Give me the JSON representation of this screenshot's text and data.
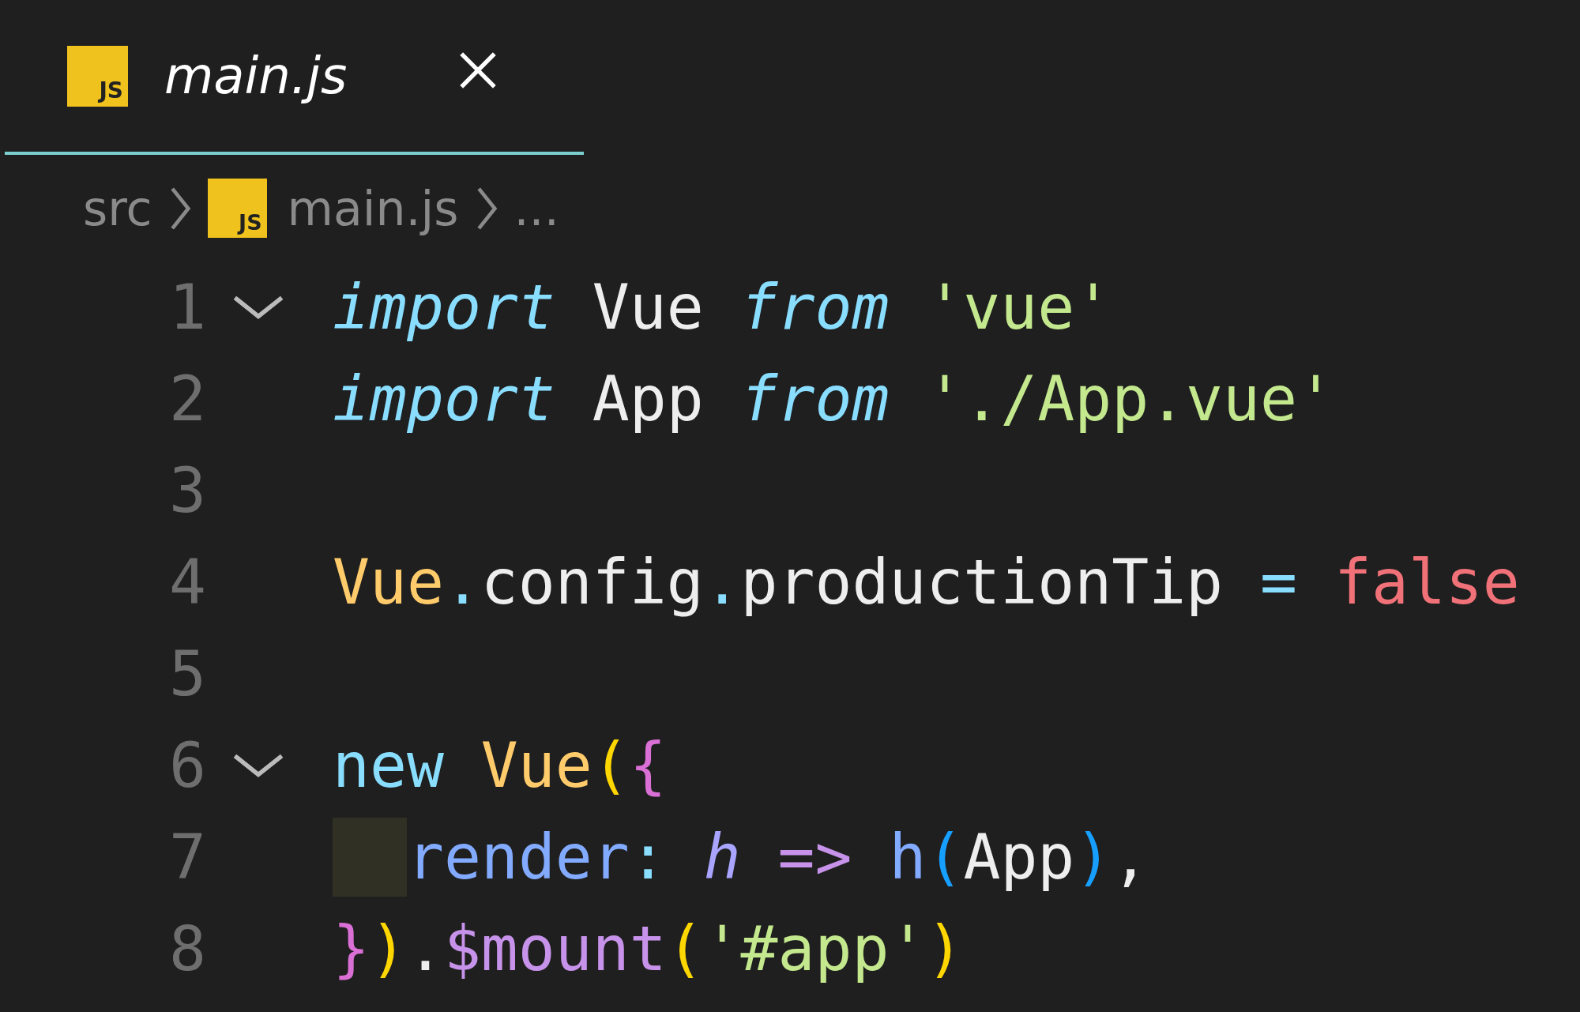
{
  "tabs": [
    {
      "label": "main.js",
      "icon_text": "JS",
      "selected": true,
      "preview": true
    }
  ],
  "breadcrumbs": [
    {
      "kind": "folder",
      "label": "src"
    },
    {
      "kind": "file",
      "label": "main.js",
      "icon_text": "JS"
    },
    {
      "kind": "more",
      "label": "..."
    }
  ],
  "lines": [
    {
      "number": "1",
      "foldable": true,
      "indented": false,
      "tokens": [
        {
          "kind": "keyword",
          "text": "import"
        },
        {
          "kind": "identifier",
          "text": " Vue"
        },
        {
          "kind": "keyword",
          "text": " from"
        },
        {
          "kind": "string",
          "text": " 'vue'"
        }
      ]
    },
    {
      "number": "2",
      "foldable": false,
      "indented": false,
      "tokens": [
        {
          "kind": "keyword",
          "text": "import"
        },
        {
          "kind": "identifier",
          "text": " App"
        },
        {
          "kind": "keyword",
          "text": " from"
        },
        {
          "kind": "string",
          "text": " './App.vue'"
        }
      ]
    },
    {
      "number": "3",
      "foldable": false,
      "indented": false
    },
    {
      "number": "4",
      "foldable": false,
      "indented": false,
      "tokens": [
        {
          "kind": "class",
          "text": "Vue"
        },
        {
          "kind": "operator",
          "text": "."
        },
        {
          "kind": "identifier",
          "text": "config"
        },
        {
          "kind": "operator",
          "text": "."
        },
        {
          "kind": "identifier",
          "text": "productionTip"
        },
        {
          "kind": "operator",
          "text": " ="
        },
        {
          "kind": "boolean",
          "text": " false"
        }
      ]
    },
    {
      "number": "5",
      "foldable": false,
      "indented": false
    },
    {
      "number": "6",
      "foldable": true,
      "indented": false,
      "tokens": [
        {
          "kind": "storage",
          "text": "new"
        },
        {
          "kind": "class",
          "text": " Vue"
        },
        {
          "kind": "bracket1",
          "text": "("
        },
        {
          "kind": "bracket2",
          "text": "{"
        }
      ]
    },
    {
      "number": "7",
      "foldable": false,
      "indented": true,
      "tokens": [
        {
          "kind": "property",
          "text": "render"
        },
        {
          "kind": "operator",
          "text": ":"
        },
        {
          "kind": "param",
          "text": " h"
        },
        {
          "kind": "arrow",
          "text": " =>"
        },
        {
          "kind": "function",
          "text": " h"
        },
        {
          "kind": "bracket3",
          "text": "("
        },
        {
          "kind": "identifier",
          "text": "App"
        },
        {
          "kind": "bracket3",
          "text": ")"
        },
        {
          "kind": "identifier",
          "text": ","
        }
      ]
    },
    {
      "number": "8",
      "foldable": false,
      "indented": false,
      "tokens": [
        {
          "kind": "bracket2",
          "text": "}"
        },
        {
          "kind": "bracket1",
          "text": ")"
        },
        {
          "kind": "identifier",
          "text": "."
        },
        {
          "kind": "method",
          "text": "$mount"
        },
        {
          "kind": "bracket1",
          "text": "("
        },
        {
          "kind": "string",
          "text": "'#app'"
        },
        {
          "kind": "bracket1",
          "text": ")"
        }
      ]
    }
  ]
}
